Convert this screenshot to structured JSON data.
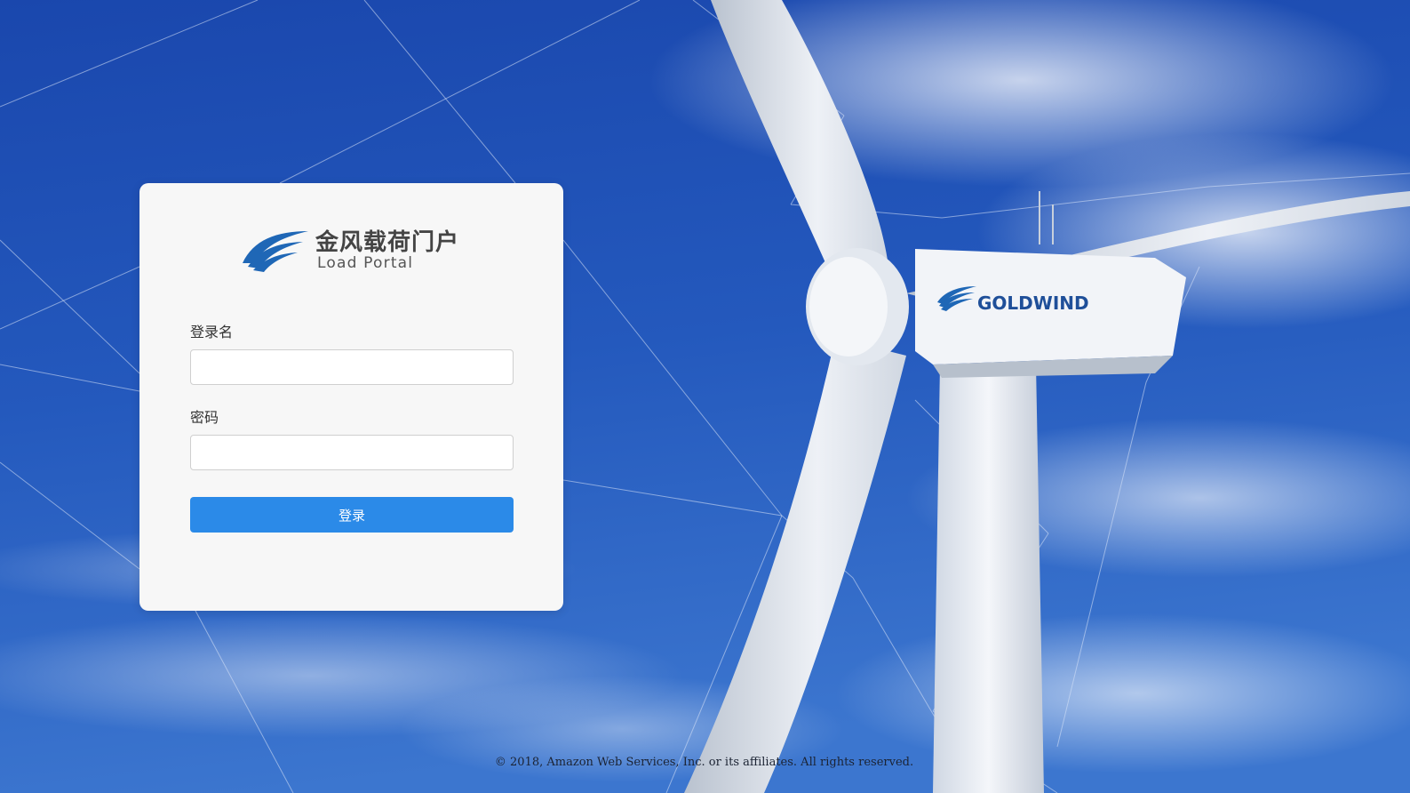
{
  "background": {
    "description_icon": "wind-turbine-icon",
    "nacelle_brand": "GOLDWIND",
    "colors": {
      "sky_top": "#1e4fb5",
      "sky_bottom": "#3b73cf",
      "turbine": "#eef2f7"
    }
  },
  "logo": {
    "icon": "goldwind-swoosh-icon",
    "title": "金风载荷门户",
    "subtitle": "Load Portal",
    "brand_color": "#1f67b6"
  },
  "login_form": {
    "username_label": "登录名",
    "username_value": "",
    "password_label": "密码",
    "password_value": "",
    "submit_label": "登录",
    "accent_color": "#2b8ae8"
  },
  "footer": {
    "copyright": "© 2018, Amazon Web Services, Inc. or its affiliates. All rights reserved."
  }
}
